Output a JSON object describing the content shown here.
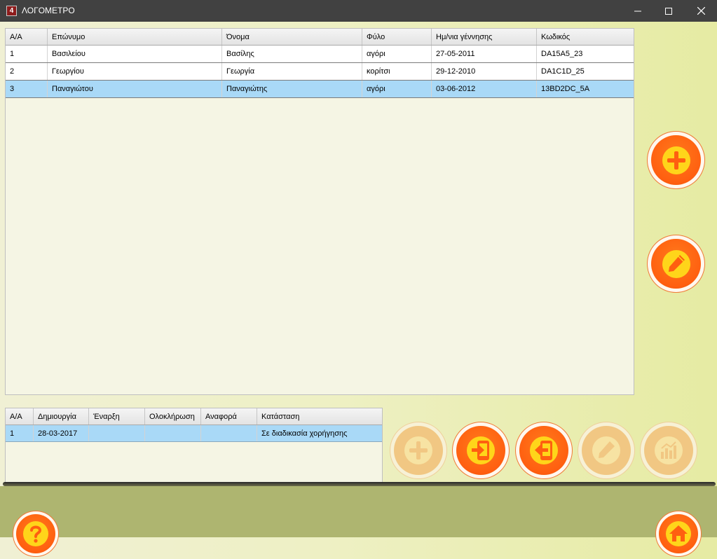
{
  "window": {
    "title": "ΛΟΓΟΜΕΤΡΟ",
    "app_icon_glyph": "4",
    "minimize_icon": "minimize-icon",
    "maximize_icon": "maximize-icon",
    "close_icon": "close-icon"
  },
  "students_table": {
    "columns": [
      "Α/Α",
      "Επώνυμο",
      "Όνομα",
      "Φύλο",
      "Ημ/νια γέννησης",
      "Κωδικός"
    ],
    "rows": [
      [
        "1",
        "Βασιλείου",
        "Βασίλης",
        "αγόρι",
        "27-05-2011",
        "DA15A5_23"
      ],
      [
        "2",
        "Γεωργίου",
        "Γεωργία",
        "κορίτσι",
        "29-12-2010",
        "DA1C1D_25"
      ],
      [
        "3",
        "Παναγιώτου",
        "Παναγιώτης",
        "αγόρι",
        "03-06-2012",
        "13BD2DC_5A"
      ]
    ],
    "selected_row": 3
  },
  "tests_table": {
    "columns": [
      "Α/Α",
      "Δημιουργία",
      "Έναρξη",
      "Ολοκλήρωση",
      "Αναφορά",
      "Κατάσταση"
    ],
    "rows": [
      [
        "1",
        "28-03-2017",
        "",
        "",
        "",
        "Σε διαδικασία χορήγησης"
      ]
    ],
    "selected_row": 1
  },
  "side_buttons": {
    "add_student": {
      "icon": "plus-icon",
      "enabled": true
    },
    "edit_student": {
      "icon": "pencil-icon",
      "enabled": true
    }
  },
  "test_buttons": {
    "add_test": {
      "icon": "plus-icon",
      "enabled": false
    },
    "export_to_tablet": {
      "icon": "tablet-import-icon",
      "enabled": true
    },
    "import_from_tablet": {
      "icon": "tablet-export-icon",
      "enabled": true
    },
    "edit_test": {
      "icon": "pencil-icon",
      "enabled": false
    },
    "report": {
      "icon": "chart-icon",
      "enabled": false
    }
  },
  "footer": {
    "help": {
      "icon": "question-icon",
      "glyph": "?"
    },
    "home": {
      "icon": "home-icon"
    }
  },
  "colors": {
    "accent_orange": "#ff5f10",
    "selection_blue": "#a9d9f7",
    "background_green": "#e6eba6",
    "footer_green": "#aeb570"
  }
}
